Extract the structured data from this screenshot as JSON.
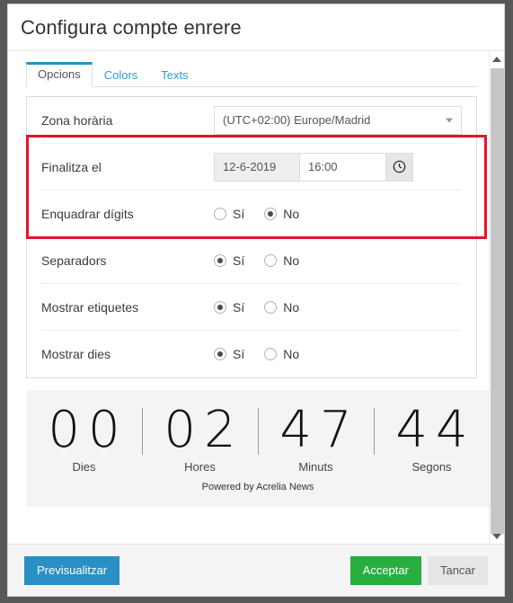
{
  "dialog": {
    "title": "Configura compte enrere"
  },
  "tabs": [
    {
      "label": "Opcions",
      "active": true
    },
    {
      "label": "Colors",
      "active": false
    },
    {
      "label": "Texts",
      "active": false
    }
  ],
  "form": {
    "timezone": {
      "label": "Zona horària",
      "value": "(UTC+02:00) Europe/Madrid"
    },
    "ends_at": {
      "label": "Finalitza el",
      "date_value": "12-6-2019",
      "time_value": "16:00"
    },
    "radio_rows": [
      {
        "label": "Enquadrar dígits",
        "yes_label": "Sí",
        "no_label": "No",
        "selected": "no"
      },
      {
        "label": "Separadors",
        "yes_label": "Sí",
        "no_label": "No",
        "selected": "yes"
      },
      {
        "label": "Mostrar etiquetes",
        "yes_label": "Sí",
        "no_label": "No",
        "selected": "yes"
      },
      {
        "label": "Mostrar dies",
        "yes_label": "Sí",
        "no_label": "No",
        "selected": "yes"
      }
    ]
  },
  "countdown": {
    "units": [
      {
        "digits": "00",
        "label": "Dies"
      },
      {
        "digits": "02",
        "label": "Hores"
      },
      {
        "digits": "47",
        "label": "Minuts"
      },
      {
        "digits": "44",
        "label": "Segons"
      }
    ],
    "powered_by": "Powered by Acrelia News"
  },
  "footer": {
    "preview_label": "Previsualitzar",
    "accept_label": "Acceptar",
    "close_label": "Tancar"
  },
  "colors": {
    "accent_blue": "#2a8fc4",
    "link_blue": "#2a9fd6",
    "accept_green": "#27ae3f",
    "highlight_red": "#e8112d",
    "backdrop": "#58585a",
    "preview_bg": "#f4f4f4"
  }
}
